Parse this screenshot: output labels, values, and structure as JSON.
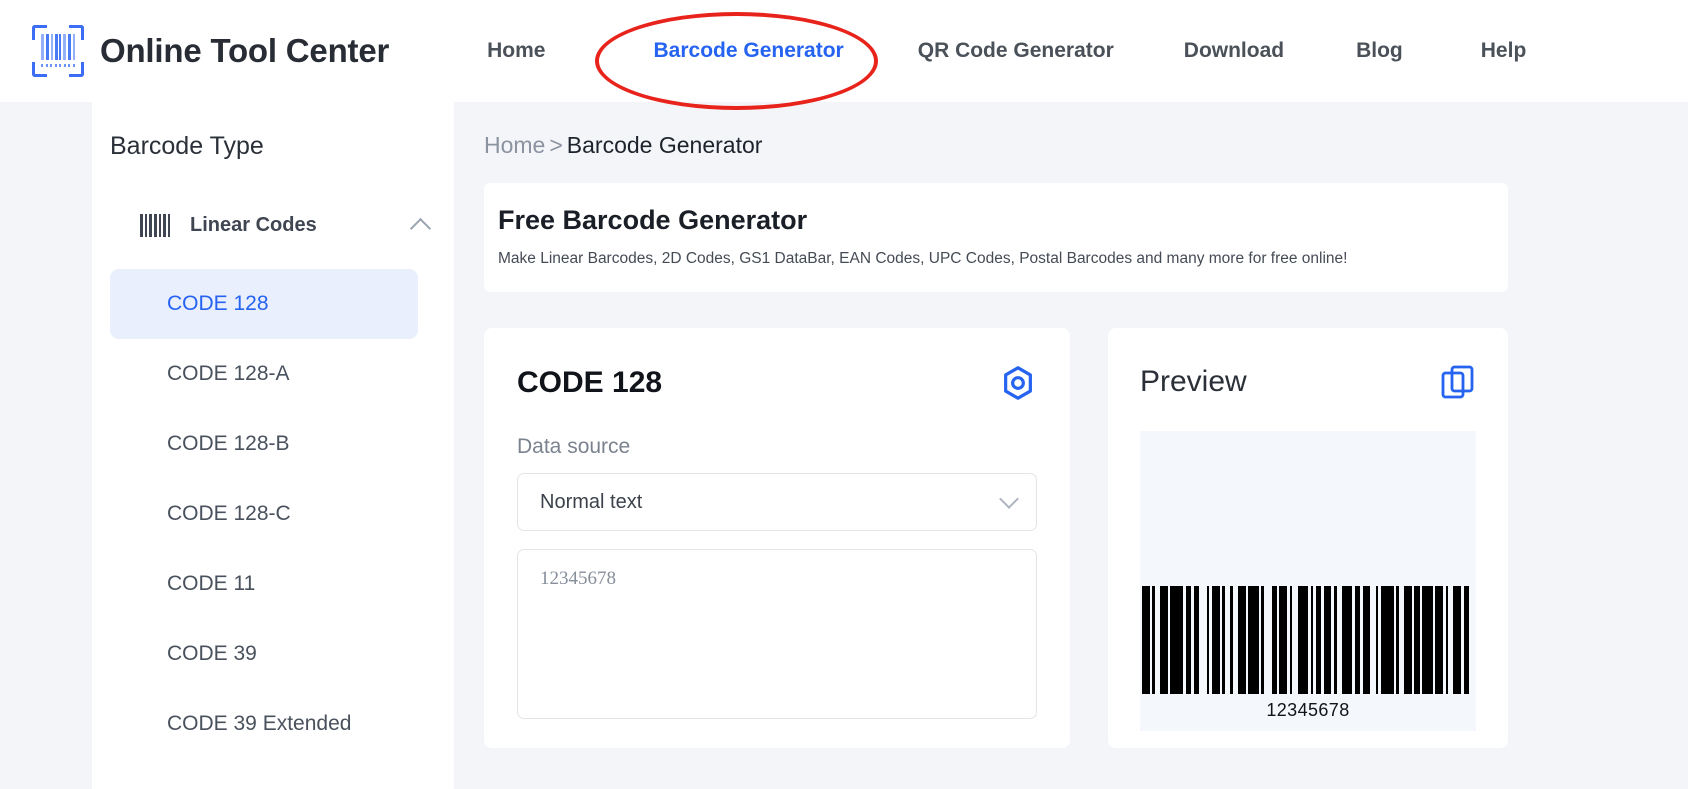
{
  "header": {
    "brand_name": "Online Tool Center",
    "logo_icon": "barcode-scan-icon",
    "nav": [
      {
        "label": "Home",
        "active": false
      },
      {
        "label": "Barcode Generator",
        "active": true
      },
      {
        "label": "QR Code Generator",
        "active": false
      },
      {
        "label": "Download",
        "active": false
      },
      {
        "label": "Blog",
        "active": false
      },
      {
        "label": "Help",
        "active": false
      }
    ],
    "annotation": {
      "shape": "ellipse",
      "color": "#e8231c",
      "targets": "Barcode Generator"
    }
  },
  "sidebar": {
    "title": "Barcode Type",
    "group": {
      "label": "Linear Codes",
      "icon": "barcode-icon",
      "chevron": "chevron-up-icon",
      "expanded": true
    },
    "items": [
      {
        "label": "CODE 128",
        "selected": true
      },
      {
        "label": "CODE 128-A",
        "selected": false
      },
      {
        "label": "CODE 128-B",
        "selected": false
      },
      {
        "label": "CODE 128-C",
        "selected": false
      },
      {
        "label": "CODE 11",
        "selected": false
      },
      {
        "label": "CODE 39",
        "selected": false
      },
      {
        "label": "CODE 39 Extended",
        "selected": false
      }
    ]
  },
  "breadcrumb": {
    "home": "Home",
    "separator": ">",
    "current": "Barcode Generator"
  },
  "banner": {
    "title": "Free Barcode Generator",
    "subtitle": "Make Linear Barcodes, 2D Codes, GS1 DataBar, EAN Codes, UPC Codes, Postal Barcodes and many more for free online!"
  },
  "form_card": {
    "title": "CODE 128",
    "settings_icon": "hexagon-settings-icon",
    "data_source_label": "Data source",
    "data_source_value": "Normal text",
    "data_source_chevron": "chevron-down-icon",
    "content_placeholder": "12345678"
  },
  "preview_card": {
    "title": "Preview",
    "copy_icon": "copy-icon",
    "barcode_value": "12345678",
    "barcode_caption": "12345678"
  },
  "colors": {
    "accent_blue": "#2563f0",
    "annotation_red": "#e8231c",
    "page_bg": "#f4f5f9",
    "card_bg": "#ffffff",
    "selected_item_bg": "#e9effc",
    "preview_stage_bg": "#f4f7fc"
  }
}
